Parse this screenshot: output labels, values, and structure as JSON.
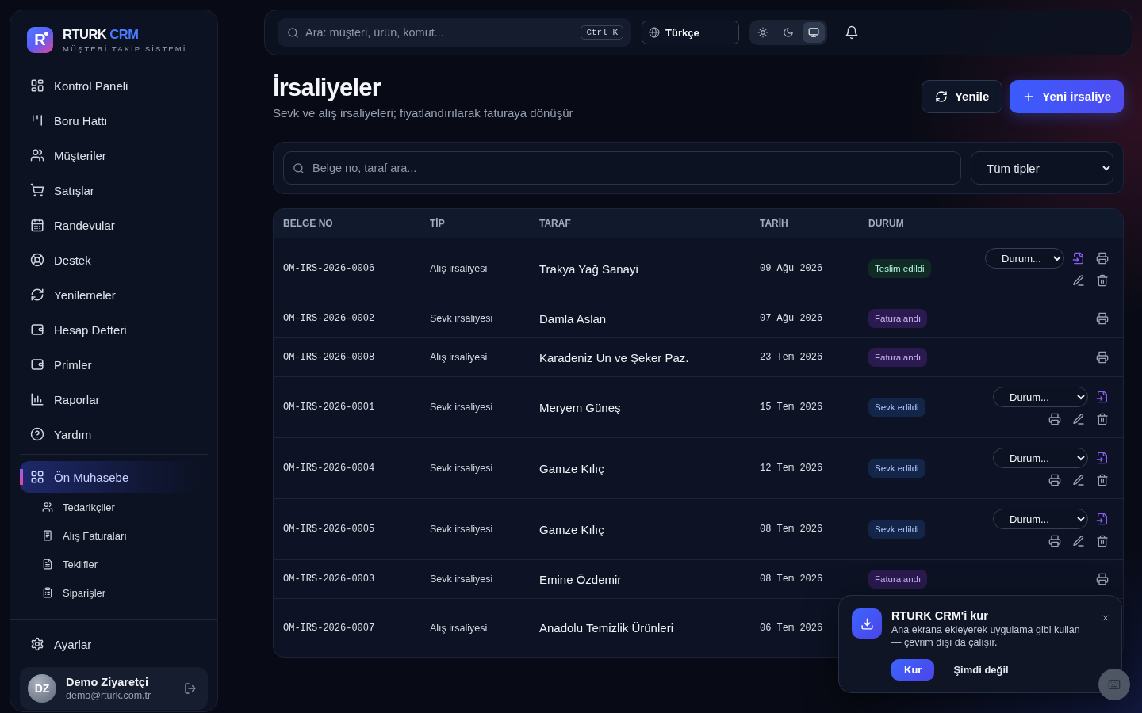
{
  "sidebar": {
    "brand": {
      "logo_letter": "R",
      "name": "RTURK",
      "name_accent": "CRM",
      "tagline": "MÜŞTERİ TAKİP SİSTEMİ"
    },
    "nav": [
      {
        "label": "Kontrol Paneli",
        "selected": false
      },
      {
        "label": "Boru Hattı",
        "selected": false
      },
      {
        "label": "Müşteriler",
        "selected": false
      },
      {
        "label": "Satışlar",
        "selected": false
      },
      {
        "label": "Randevular",
        "selected": false
      },
      {
        "label": "Destek",
        "selected": false
      },
      {
        "label": "Yenilemeler",
        "selected": false
      },
      {
        "label": "Hesap Defteri",
        "selected": false
      },
      {
        "label": "Primler",
        "selected": false
      },
      {
        "label": "Raporlar",
        "selected": false
      },
      {
        "label": "Yardım",
        "selected": false
      }
    ],
    "modules": [
      {
        "label": "Ön Muhasebe",
        "selected": true,
        "children": [
          {
            "label": "Tedarikçiler",
            "selected": false
          },
          {
            "label": "Alış Faturaları",
            "selected": false
          },
          {
            "label": "Teklifler",
            "selected": false
          },
          {
            "label": "Siparişler",
            "selected": false
          }
        ]
      }
    ],
    "footer_items": [
      {
        "label": "Ayarlar",
        "selected": false
      }
    ],
    "user": {
      "initials": "DZ",
      "name": "Demo Ziyaretçi",
      "email": "demo@rturk.com.tr"
    }
  },
  "topbar": {
    "search": {
      "placeholder": "Ara: müşteri, ürün, komut...",
      "shortcut": "Ctrl K"
    },
    "language": "Türkçe",
    "theme_modes": [
      {
        "kind": "light",
        "selected": false
      },
      {
        "kind": "dark",
        "selected": false
      },
      {
        "kind": "system",
        "selected": true
      }
    ]
  },
  "page": {
    "title": "İrsaliyeler",
    "subtitle": "Sevk ve alış irsaliyeleri; fiyatlandırılarak faturaya dönüşür",
    "buttons": [
      {
        "label": "Yenile",
        "kind": "secondary"
      },
      {
        "label": "Yeni irsaliye",
        "kind": "primary"
      }
    ]
  },
  "filters": {
    "search": {
      "placeholder": "Belge no, taraf ara..."
    },
    "type_select": "Tüm tipler"
  },
  "table": {
    "columns": [
      "BELGE NO",
      "TİP",
      "TARAF",
      "TARİH",
      "DURUM"
    ],
    "rows": [
      {
        "doc_no": "OM-IRS-2026-0006",
        "type": "Alış irsaliyesi",
        "party": "Trakya Yağ Sanayi",
        "date": "09 Ağu 2026",
        "status": {
          "label": "Teslim edildi",
          "color": "#0f2b24"
        },
        "actions": [
          [
            {
              "kind": "status-select",
              "value": "Durum..."
            },
            {
              "kind": "convert"
            },
            {
              "kind": "print"
            }
          ],
          [
            {
              "kind": "edit"
            },
            {
              "kind": "delete"
            }
          ]
        ]
      },
      {
        "doc_no": "OM-IRS-2026-0002",
        "type": "Sevk irsaliyesi",
        "party": "Damla Aslan",
        "date": "07 Ağu 2026",
        "status": {
          "label": "Faturalandı",
          "color": "#2a1a4f"
        },
        "actions": [
          [
            {
              "kind": "print"
            }
          ]
        ]
      },
      {
        "doc_no": "OM-IRS-2026-0008",
        "type": "Alış irsaliyesi",
        "party": "Karadeniz Un ve Şeker Paz.",
        "date": "23 Tem 2026",
        "status": {
          "label": "Faturalandı",
          "color": "#2a1a4f"
        },
        "actions": [
          [
            {
              "kind": "print"
            }
          ]
        ]
      },
      {
        "doc_no": "OM-IRS-2026-0001",
        "type": "Sevk irsaliyesi",
        "party": "Meryem Güneş",
        "date": "15 Tem 2026",
        "status": {
          "label": "Sevk edildi",
          "color": "#14254a"
        },
        "actions": [
          [
            {
              "kind": "status-select",
              "value": "Durum..."
            },
            {
              "kind": "convert"
            }
          ],
          [
            {
              "kind": "print"
            },
            {
              "kind": "edit"
            },
            {
              "kind": "delete"
            }
          ]
        ]
      },
      {
        "doc_no": "OM-IRS-2026-0004",
        "type": "Sevk irsaliyesi",
        "party": "Gamze Kılıç",
        "date": "12 Tem 2026",
        "status": {
          "label": "Sevk edildi",
          "color": "#14254a"
        },
        "actions": [
          [
            {
              "kind": "status-select",
              "value": "Durum..."
            },
            {
              "kind": "convert"
            }
          ],
          [
            {
              "kind": "print"
            },
            {
              "kind": "edit"
            },
            {
              "kind": "delete"
            }
          ]
        ]
      },
      {
        "doc_no": "OM-IRS-2026-0005",
        "type": "Sevk irsaliyesi",
        "party": "Gamze Kılıç",
        "date": "08 Tem 2026",
        "status": {
          "label": "Sevk edildi",
          "color": "#14254a"
        },
        "actions": [
          [
            {
              "kind": "status-select",
              "value": "Durum..."
            },
            {
              "kind": "convert"
            }
          ],
          [
            {
              "kind": "print"
            },
            {
              "kind": "edit"
            },
            {
              "kind": "delete"
            }
          ]
        ]
      },
      {
        "doc_no": "OM-IRS-2026-0003",
        "type": "Sevk irsaliyesi",
        "party": "Emine Özdemir",
        "date": "08 Tem 2026",
        "status": {
          "label": "Faturalandı",
          "color": "#2a1a4f"
        },
        "actions": [
          [
            {
              "kind": "print"
            }
          ]
        ]
      },
      {
        "doc_no": "OM-IRS-2026-0007",
        "type": "Alış irsaliyesi",
        "party": "Anadolu Temizlik Ürünleri",
        "date": "06 Tem 2026"
      }
    ]
  },
  "install_prompt": {
    "title": "RTURK CRM'i kur",
    "message": "Ana ekrana ekleyerek uygulama gibi kullan — çevrim dışı da çalışır.",
    "buttons": [
      {
        "label": "Kur",
        "kind": "primary"
      },
      {
        "label": "Şimdi değil",
        "kind": "text"
      }
    ]
  }
}
